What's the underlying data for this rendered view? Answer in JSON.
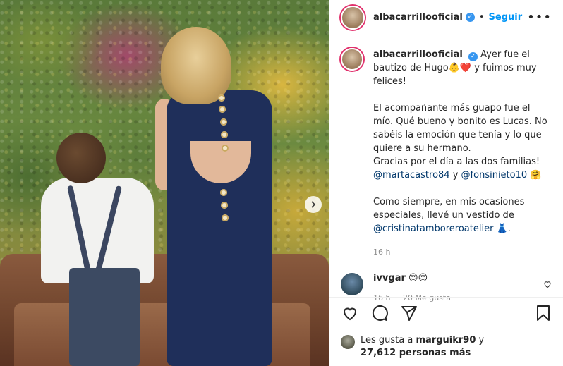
{
  "header": {
    "username": "albacarrillooficial",
    "separator": "•",
    "follow_label": "Seguir",
    "more_label": "•••"
  },
  "caption": {
    "username": "albacarrillooficial",
    "line1": "Ayer fue el bautizo",
    "line2_start": "de Hugo",
    "line2_emojis": "👶❤️",
    "line2_end": " y fuimos muy felices!",
    "para2": "El acompañante más guapo fue el mío. Qué bueno y bonito es Lucas. No sabéis la emoción que tenía y lo que quiere a su hermano.",
    "para3": "Gracias por el día a las dos familias!",
    "mention1": "@martacastro84",
    "mention_join": " y ",
    "mention2": "@fonsinieto10",
    "mention_emoji": " 🤗",
    "para4": "Como siempre, en mis ocasiones especiales, llevé un vestido de",
    "mention3": "@cristinatamboreroatelier",
    "mention3_emoji": " 👗.",
    "time": "16 h"
  },
  "comment": {
    "username": "ivvgar",
    "emojis": "😍😍",
    "time": "16 h",
    "likes": "20 Me gusta"
  },
  "likes": {
    "prefix": "Les gusta a ",
    "user": "marguikr90",
    "suffix": " y",
    "count": "27,612 personas más"
  },
  "icons": [
    "verified-badge-icon",
    "more-options-icon",
    "heart-icon",
    "comment-icon",
    "share-icon",
    "bookmark-icon",
    "chevron-right-icon"
  ],
  "colors": {
    "link": "#0095f6",
    "mention": "#00376b",
    "muted": "#8e8e8e",
    "story_ring": "#e1306c"
  }
}
